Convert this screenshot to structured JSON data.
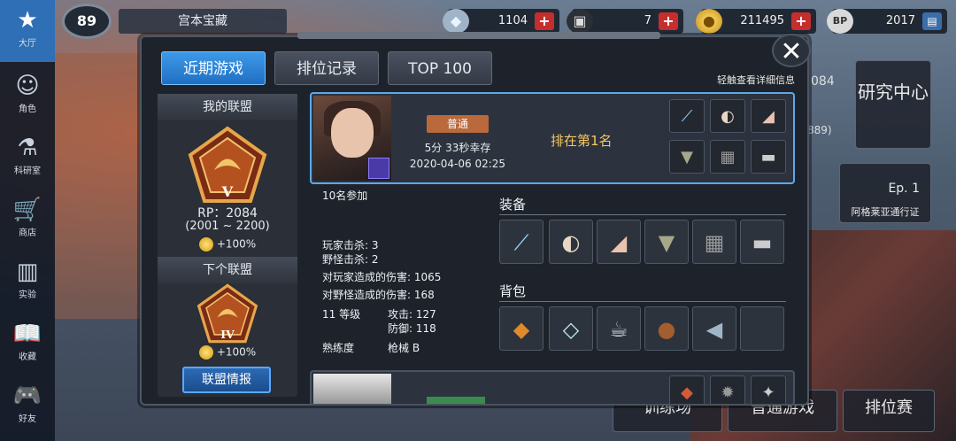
{
  "nav": [
    {
      "label": "大厅",
      "icon": "star-icon",
      "active": true
    },
    {
      "label": "角色",
      "icon": "character-icon"
    },
    {
      "label": "科研室",
      "icon": "flask-icon"
    },
    {
      "label": "商店",
      "icon": "cart-icon"
    },
    {
      "label": "实验",
      "icon": "books-icon"
    },
    {
      "label": "收藏",
      "icon": "book-icon"
    },
    {
      "label": "好友",
      "icon": "gamepad-icon"
    }
  ],
  "topbar": {
    "level": "89",
    "player_name": "宫本宝藏",
    "resources": [
      {
        "icon": "crystal-icon",
        "value": "1104",
        "has_plus": true
      },
      {
        "icon": "box-icon",
        "value": "7",
        "has_plus": true
      },
      {
        "icon": "gold-coin-icon",
        "value": "211495",
        "has_plus": true
      },
      {
        "icon": "bp-icon",
        "value": "2017",
        "has_plus": false
      }
    ]
  },
  "background": {
    "research_center": "研究中心",
    "partial_number": "084",
    "partial_number2": "889)",
    "pass_label": "阿格莱亚通行证",
    "pass_ep": "Ep. 1",
    "training": "训练场",
    "normal_game": "普通游戏",
    "ranked": "排位赛"
  },
  "modal": {
    "tabs": [
      {
        "label": "近期游戏",
        "active": true
      },
      {
        "label": "排位记录",
        "active": false
      },
      {
        "label": "TOP 100",
        "active": false
      }
    ],
    "hint": "轻触查看详细信息",
    "close_symbol": "✕"
  },
  "league": {
    "my_title": "我的联盟",
    "my_tier": "V",
    "rp": "RP：2084",
    "rp_range": "(2001 ~ 2200)",
    "my_bonus": "+100%",
    "next_title": "下个联盟",
    "next_tier": "IV",
    "next_bonus": "+100%",
    "info_button": "联盟情报"
  },
  "record": {
    "mode": "普通",
    "survive": "5分 33秒幸存",
    "date": "2020-04-06 02:25",
    "rank": "排在第1名",
    "card_items": [
      "sword-icon",
      "mask-icon",
      "blade-icon",
      "armor-icon",
      "gear-icon",
      "gun-icon"
    ]
  },
  "details": {
    "participants": "10名参加",
    "player_kills": "玩家击杀: 3",
    "monster_kills": "野怪击杀: 2",
    "player_damage": "对玩家造成的伤害: 1065",
    "monster_damage": "对野怪造成的伤害: 168",
    "level": "11 等级",
    "attack": "攻击: 127",
    "defense": "防御: 118",
    "proficiency_label": "熟练度",
    "proficiency_value": "枪械 B",
    "equipment_title": "装备",
    "equipment": [
      "sword-icon",
      "mask-icon",
      "blade-icon",
      "armor-icon",
      "gear-icon",
      "gun-icon"
    ],
    "bag_title": "背包",
    "bag": [
      "chips-icon",
      "ice-icon",
      "cup-icon",
      "steak-icon",
      "fish-icon",
      ""
    ]
  },
  "colors": {
    "accent_blue": "#2f8be0",
    "rank_gold": "#f3c764",
    "plus_red": "#c62e2e",
    "mode_chip": "#b9693b"
  }
}
